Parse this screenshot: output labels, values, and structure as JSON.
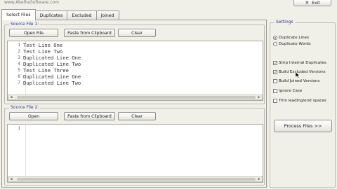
{
  "brand": "www.AbelhaSoftware.com",
  "exit_label": "Exit",
  "tabs": [
    "Select Files",
    "Duplicates",
    "Excluded",
    "Joined"
  ],
  "source1": {
    "title": "Source File 1:",
    "buttons": [
      "Open File",
      "Paste from Clipboard",
      "Clear"
    ],
    "lines": [
      {
        "n": "1",
        "text": "Test Line One"
      },
      {
        "n": "2",
        "text": "Test Line Two"
      },
      {
        "n": "3",
        "text": "Duplicated Line One"
      },
      {
        "n": "4",
        "text": "Duplicated Line Two"
      },
      {
        "n": "5",
        "text": "Test Line Three"
      },
      {
        "n": "6",
        "text": "Duplicated Line One"
      },
      {
        "n": "7",
        "text": "Duplicated Line Two"
      }
    ]
  },
  "source2": {
    "title": "Source File 2:",
    "buttons": [
      "Open",
      "Paste from Clipboard",
      "Clear"
    ],
    "lines": [
      {
        "n": "1",
        "text": ""
      }
    ]
  },
  "settings": {
    "title": "Settings",
    "radios": [
      {
        "label": "Duplicate Lines",
        "selected": true
      },
      {
        "label": "Duplicate Words",
        "selected": false
      }
    ],
    "checks": [
      {
        "label": "Strip Internal Duplicates",
        "checked": true
      },
      {
        "label": "Build Excluded Versions",
        "checked": true
      },
      {
        "label": "Build Joined Versions",
        "checked": false
      },
      {
        "label": "Ignore Case",
        "checked": false
      },
      {
        "label": "Trim leading/end spaces",
        "checked": false
      }
    ],
    "process_label": "Process Files >>"
  },
  "icons": {
    "exit": "close-x-icon",
    "scroll_left": "arrow-left-icon",
    "scroll_right": "arrow-right-icon",
    "cursor": "mouse-pointer-icon"
  }
}
